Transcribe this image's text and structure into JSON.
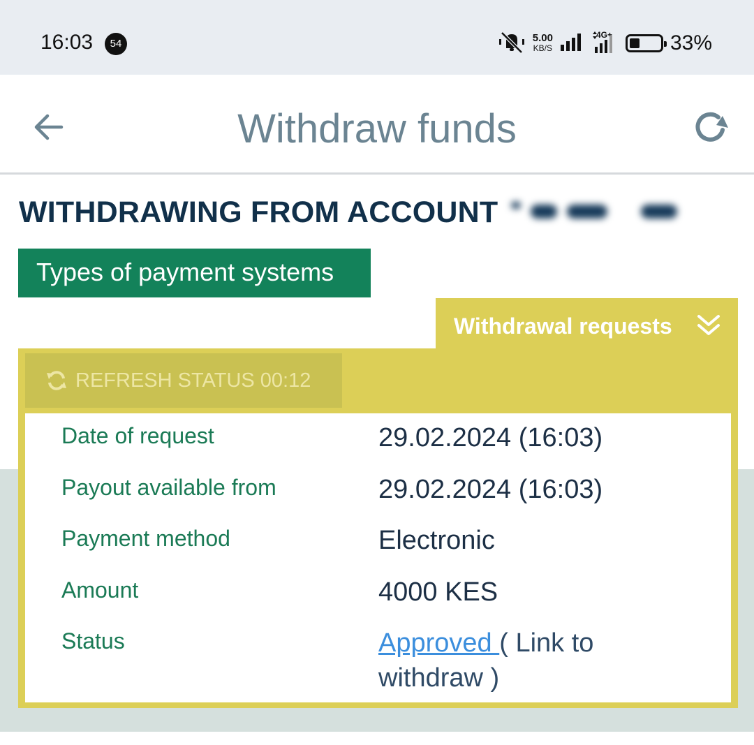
{
  "status_bar": {
    "time": "16:03",
    "notification_count": "54",
    "net_speed_value": "5.00",
    "net_speed_unit": "KB/S",
    "network_type": "4G+",
    "battery_percent": "33%"
  },
  "header": {
    "title": "Withdraw funds"
  },
  "account": {
    "heading": "WITHDRAWING FROM ACCOUNT"
  },
  "tabs": {
    "payment_types": "Types of payment systems",
    "withdrawal_requests": "Withdrawal requests"
  },
  "refresh_status": {
    "label": "REFRESH STATUS 00:12"
  },
  "request_details": {
    "rows": [
      {
        "label": "Date of request",
        "value": "29.02.2024 (16:03)"
      },
      {
        "label": "Payout available from",
        "value": "29.02.2024 (16:03)"
      },
      {
        "label": "Payment method",
        "value": "Electronic"
      },
      {
        "label": "Amount",
        "value": "4000 KES"
      },
      {
        "label": "Status",
        "status_link": "Approved ",
        "status_suffix": "( Link to withdraw )"
      }
    ]
  },
  "colors": {
    "header_title": "#6b8492",
    "green_tab": "#13825a",
    "yellow_panel": "#dccf57",
    "label_green": "#1a7a55",
    "link_blue": "#3b8edd"
  }
}
